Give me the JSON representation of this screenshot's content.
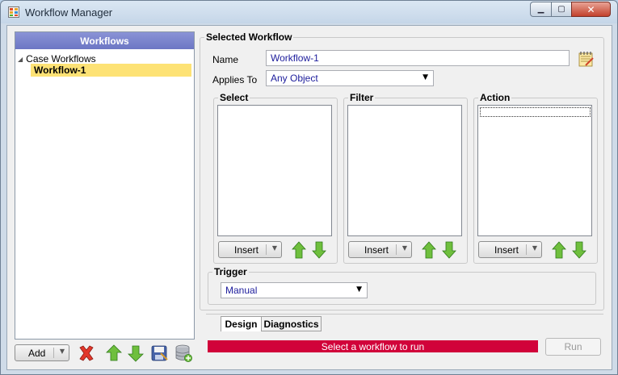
{
  "window": {
    "title": "Workflow Manager",
    "controls": {
      "minimize": "▁",
      "maximize": "▢",
      "close": "✕"
    }
  },
  "workflows_panel": {
    "header": "Workflows",
    "tree": {
      "root_label": "Case Workflows",
      "root_toggle": "◢",
      "children": [
        "Workflow-1"
      ]
    }
  },
  "toolbar": {
    "add_label": "Add",
    "dropdown_arrow": "▼",
    "icons": [
      "delete-icon",
      "move-up-icon",
      "move-down-icon",
      "save-icon",
      "database-icon"
    ]
  },
  "selected_workflow": {
    "group_title": "Selected Workflow",
    "name_label": "Name",
    "name_value": "Workflow-1",
    "applies_to_label": "Applies To",
    "applies_to_value": "Any Object",
    "notepad_icon": "notepad-icon"
  },
  "sections": {
    "select": {
      "title": "Select",
      "insert_label": "Insert"
    },
    "filter": {
      "title": "Filter",
      "insert_label": "Insert"
    },
    "action": {
      "title": "Action",
      "insert_label": "Insert"
    }
  },
  "trigger": {
    "title": "Trigger",
    "value": "Manual"
  },
  "tabs": [
    "Design",
    "Diagnostics"
  ],
  "status": {
    "message": "Select a workflow to run",
    "color": "#d1023a"
  },
  "run_label": "Run",
  "colors": {
    "header_accent": "#6c76c4",
    "selection": "#fde275",
    "arrow_green": "#4caf2a"
  }
}
